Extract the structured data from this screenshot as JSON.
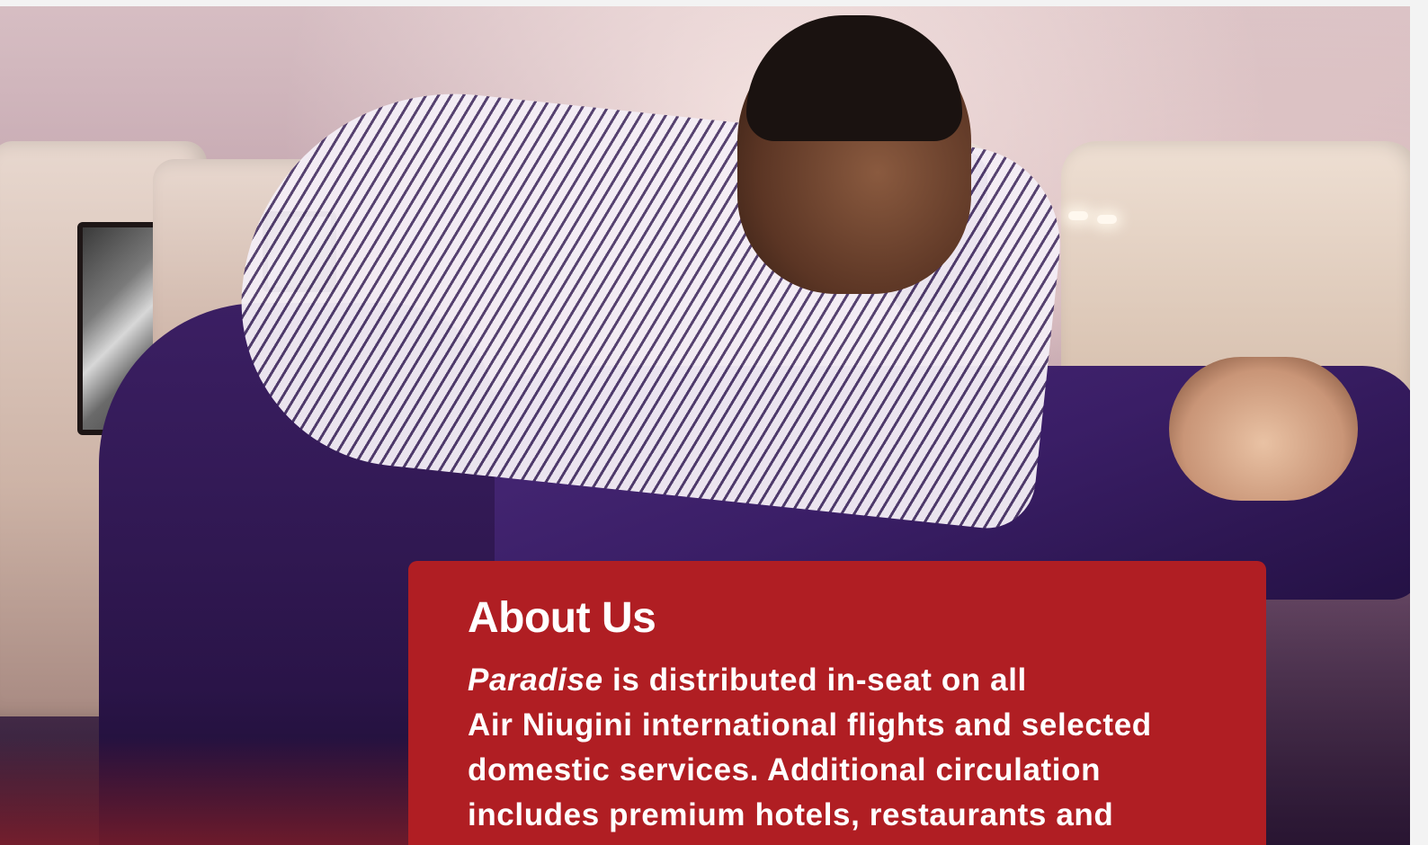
{
  "about": {
    "title": "About Us",
    "publication_name": "Paradise",
    "description_line1_rest": " is distributed in-seat on all",
    "description_rest": "Air Niugini international flights and selected domestic services. Additional circulation includes premium hotels, restaurants and"
  },
  "colors": {
    "card_background": "#b01e23",
    "card_text": "#ffffff",
    "page_background": "#f3f3f3"
  },
  "hero_image": {
    "subject": "flight attendant tucking a blanket over a sleeping passenger in an aircraft cabin"
  }
}
